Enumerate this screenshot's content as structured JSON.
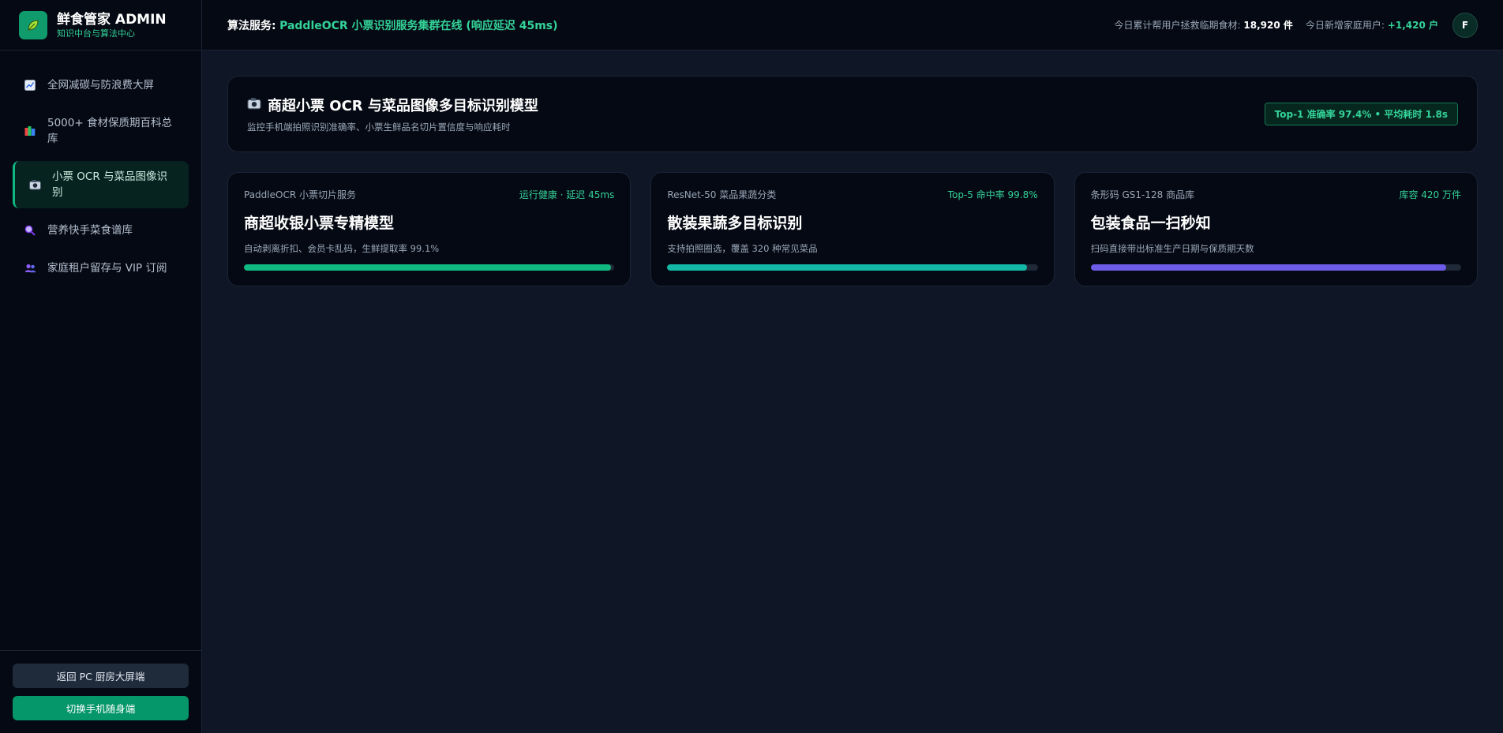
{
  "brand": {
    "title": "鲜食管家 ADMIN",
    "subtitle": "知识中台与算法中心",
    "logo_icon": "leaf-icon",
    "logo_color": "#0f9b6c"
  },
  "sidebar": {
    "items": [
      {
        "label": "全网减碳与防浪费大屏",
        "icon": "chart-icon",
        "active": false
      },
      {
        "label": "5000+ 食材保质期百科总库",
        "icon": "books-icon",
        "active": false
      },
      {
        "label": "小票 OCR 与菜品图像识别",
        "icon": "camera-icon",
        "active": true
      },
      {
        "label": "营养快手菜食谱库",
        "icon": "magnifier-icon",
        "active": false
      },
      {
        "label": "家庭租户留存与 VIP 订阅",
        "icon": "users-icon",
        "active": false
      }
    ],
    "footer": {
      "back_label": "返回 PC 厨房大屏端",
      "switch_label": "切换手机随身端"
    }
  },
  "topbar": {
    "service_label": "算法服务:",
    "service_value": "PaddleOCR 小票识别服务集群在线 (响应延迟 45ms)",
    "stat1_label": "今日累计帮用户拯救临期食材:",
    "stat1_value": "18,920 件",
    "stat2_label": "今日新增家庭用户:",
    "stat2_value": "+1,420 户",
    "avatar_initial": "F"
  },
  "header": {
    "icon": "camera-icon",
    "title": "商超小票 OCR 与菜品图像多目标识别模型",
    "subtitle": "监控手机端拍照识别准确率、小票生鲜品名切片置信度与响应耗时",
    "badge": "Top-1 准确率 97.4% • 平均耗时 1.8s"
  },
  "cards": [
    {
      "service": "PaddleOCR 小票切片服务",
      "status": "运行健康 · 延迟 45ms",
      "title": "商超收银小票专精模型",
      "desc": "自动剥离折扣、会员卡乱码，生鲜提取率 99.1%",
      "progress": 0.99,
      "color": "#10b981"
    },
    {
      "service": "ResNet-50 菜品果蔬分类",
      "status": "Top-5 命中率 99.8%",
      "title": "散装果蔬多目标识别",
      "desc": "支持拍照圈选，覆盖 320 种常见菜品",
      "progress": 0.97,
      "color": "#14b8a6"
    },
    {
      "service": "条形码 GS1-128 商品库",
      "status": "库容 420 万件",
      "title": "包装食品一扫秒知",
      "desc": "扫码直接带出标准生产日期与保质期天数",
      "progress": 0.96,
      "color": "#6d5ce8"
    }
  ],
  "colors": {
    "accent": "#10b981",
    "background": "#0f1626",
    "panel": "#050913"
  }
}
